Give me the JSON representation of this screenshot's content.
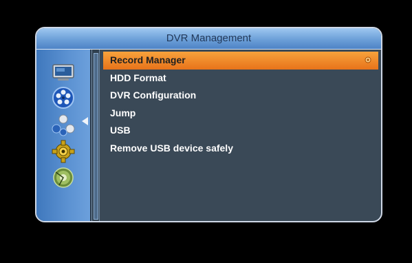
{
  "window": {
    "title": "DVR Management"
  },
  "sidebar": {
    "icons": [
      {
        "name": "tv-monitor-icon"
      },
      {
        "name": "film-reel-icon"
      },
      {
        "name": "molecule-icon"
      },
      {
        "name": "gear-icon"
      },
      {
        "name": "satellite-disc-icon"
      }
    ],
    "selected_index": 1
  },
  "menu": {
    "items": [
      {
        "label": "Record Manager",
        "selected": true
      },
      {
        "label": "HDD Format"
      },
      {
        "label": "DVR Configuration"
      },
      {
        "label": "Jump"
      },
      {
        "label": "USB"
      },
      {
        "label": "Remove USB device safely"
      }
    ]
  },
  "colors": {
    "accent": "#e8731a",
    "panel": "#3a4957",
    "title_bar": "#6c9fd8"
  }
}
